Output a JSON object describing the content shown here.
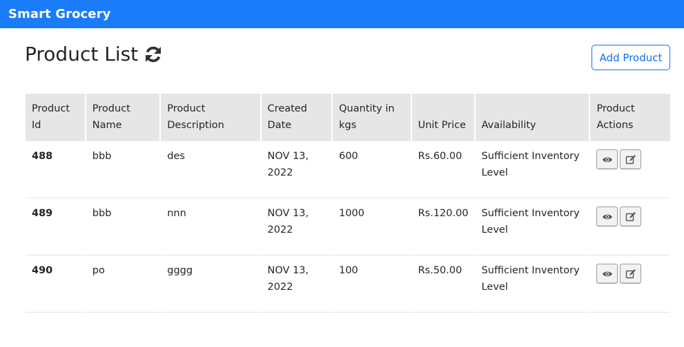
{
  "navbar": {
    "brand": "Smart Grocery"
  },
  "page": {
    "title": "Product List",
    "add_button_label": "Add Product"
  },
  "table": {
    "headers": {
      "product_id": "Product Id",
      "product_name": "Product Name",
      "product_description": "Product Description",
      "created_date": "Created Date",
      "quantity": "Quantity in kgs",
      "unit_price": "Unit Price",
      "availability": "Availability",
      "actions": "Product Actions"
    },
    "rows": [
      {
        "id": "488",
        "name": "bbb",
        "description": "des",
        "created": "NOV 13, 2022",
        "quantity": "600",
        "price": "Rs.60.00",
        "availability": "Sufficient Inventory Level"
      },
      {
        "id": "489",
        "name": "bbb",
        "description": "nnn",
        "created": "NOV 13, 2022",
        "quantity": "1000",
        "price": "Rs.120.00",
        "availability": "Sufficient Inventory Level"
      },
      {
        "id": "490",
        "name": "po",
        "description": "gggg",
        "created": "NOV 13, 2022",
        "quantity": "100",
        "price": "Rs.50.00",
        "availability": "Sufficient Inventory Level"
      }
    ]
  },
  "icons": {
    "refresh": "refresh-icon",
    "view": "eye-icon",
    "edit": "edit-icon"
  },
  "colors": {
    "navbar": "#1a7cf8",
    "accent": "#0d6efd",
    "header_bg": "#e6e6e6"
  }
}
